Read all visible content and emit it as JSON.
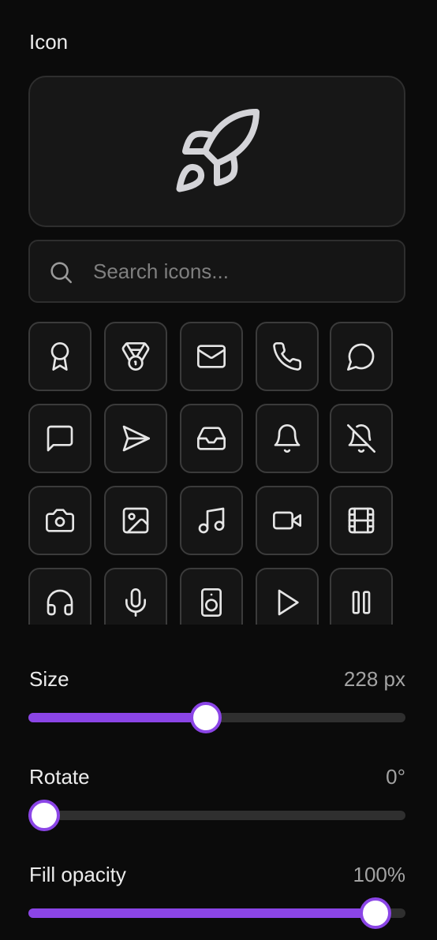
{
  "panel": {
    "label": "Icon"
  },
  "preview": {
    "icon": "rocket-icon",
    "stroke_color": "#d4d4d8"
  },
  "search": {
    "placeholder": "Search icons...",
    "value": ""
  },
  "icons": [
    "award-icon",
    "medal-icon",
    "mail-icon",
    "phone-icon",
    "message-circle-icon",
    "message-square-icon",
    "send-icon",
    "inbox-icon",
    "bell-icon",
    "bell-off-icon",
    "camera-icon",
    "image-icon",
    "music-icon",
    "video-icon",
    "film-icon",
    "headphones-icon",
    "mic-icon",
    "speaker-icon",
    "play-icon",
    "pause-icon"
  ],
  "sliders": [
    {
      "label": "Size",
      "value_text": "228 px",
      "fraction": 0.467
    },
    {
      "label": "Rotate",
      "value_text": "0°",
      "fraction": 0.0
    },
    {
      "label": "Fill opacity",
      "value_text": "100%",
      "fraction": 0.96
    }
  ],
  "colors": {
    "accent": "#8b45e6",
    "icon_stroke": "#e5e5e5",
    "background": "#0b0b0b"
  }
}
